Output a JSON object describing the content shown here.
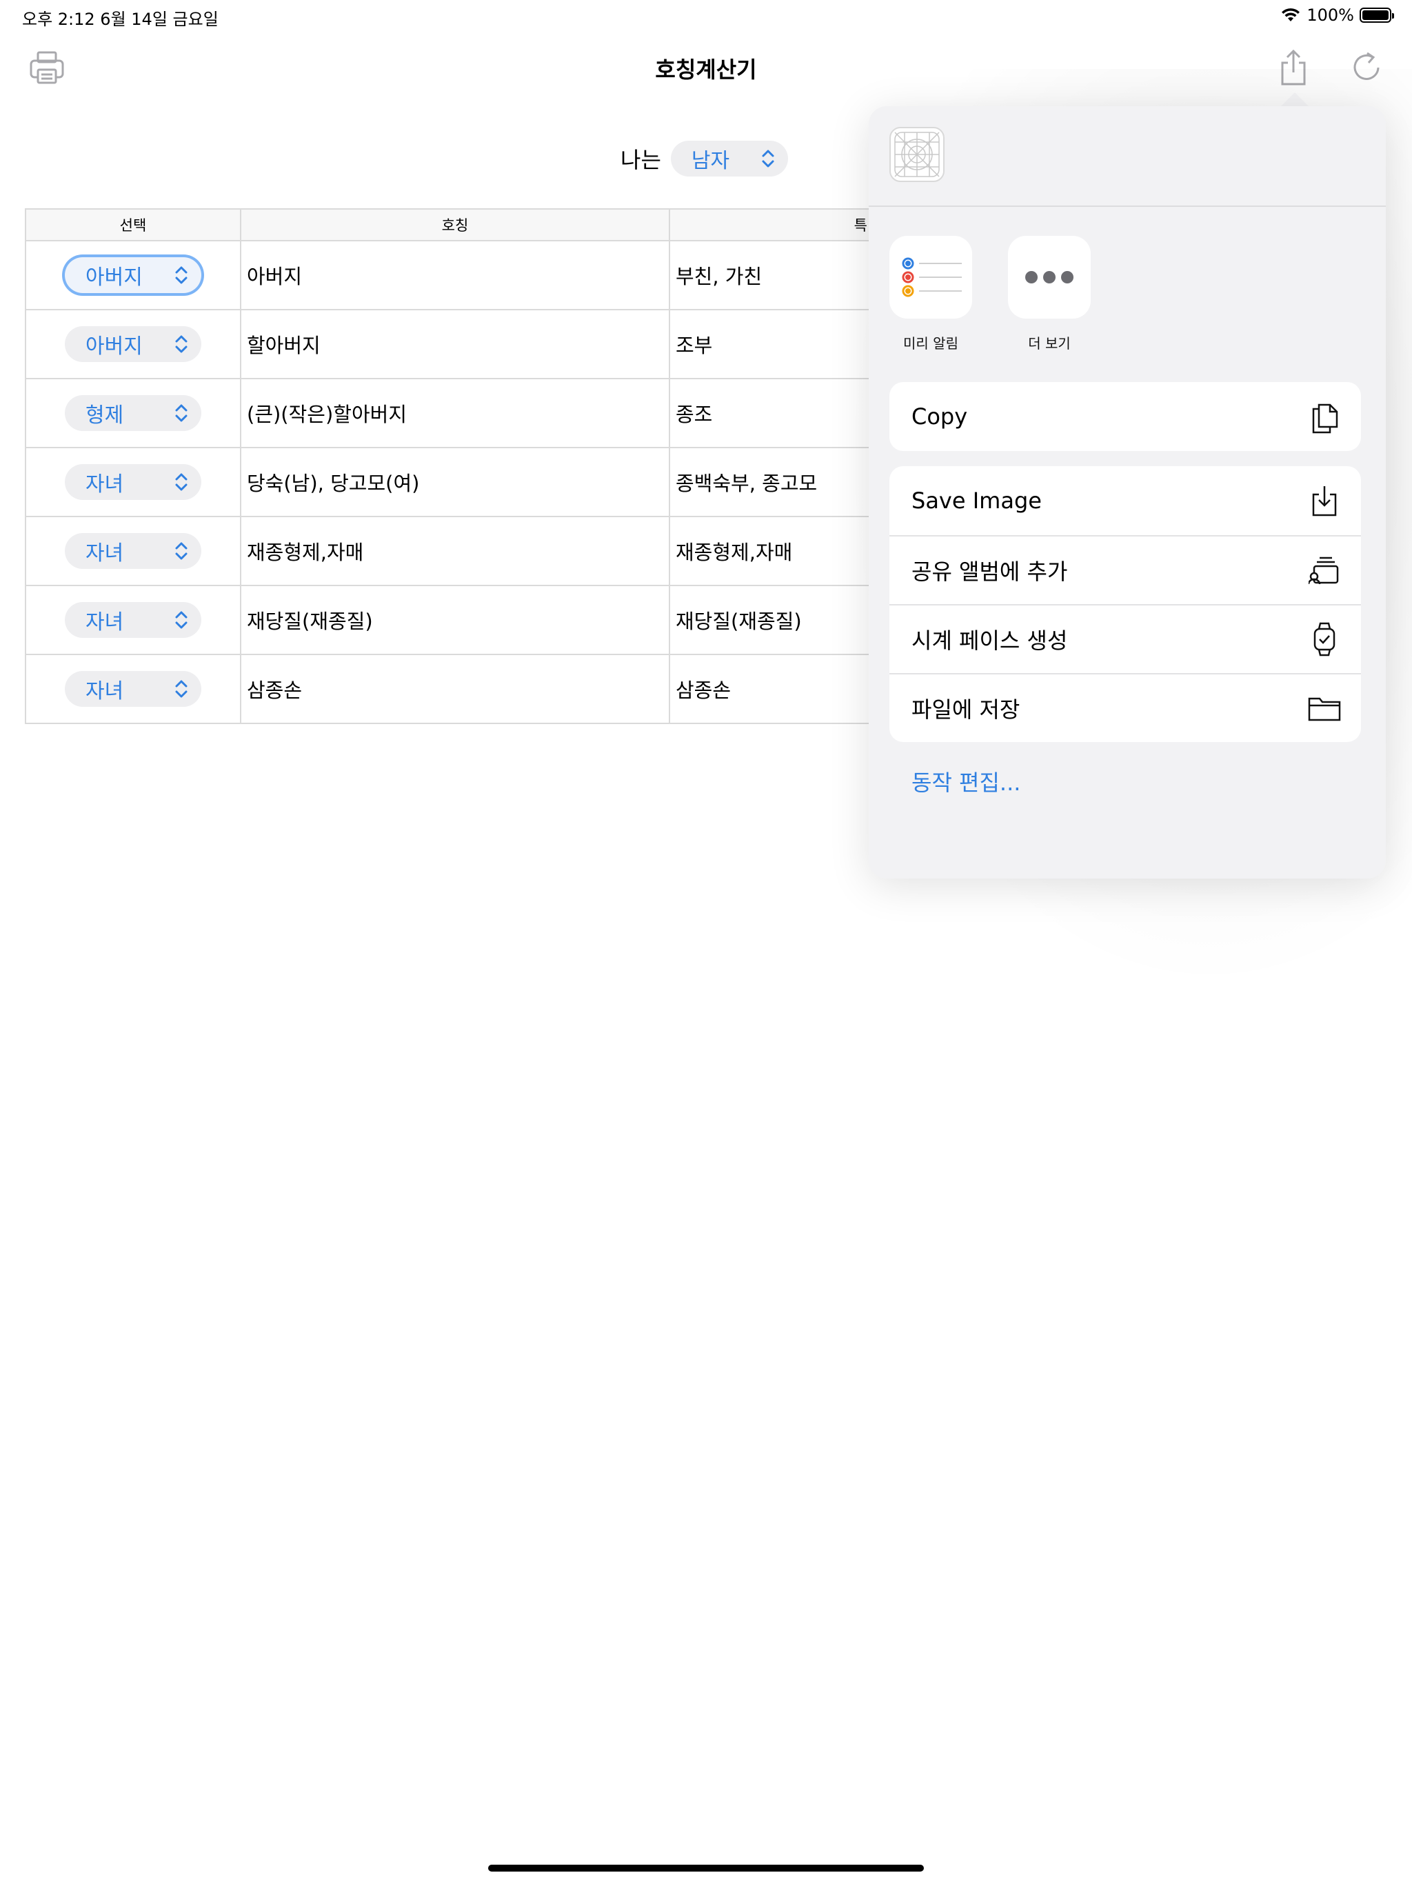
{
  "status_bar": {
    "time": "오후 2:12   6월 14일 금요일",
    "battery": "100%"
  },
  "nav": {
    "title": "호칭계산기"
  },
  "gender": {
    "label": "나는",
    "value": "남자"
  },
  "table": {
    "headers": [
      "선택",
      "호칭",
      "특"
    ],
    "rows": [
      {
        "select": "아버지",
        "title": "아버지",
        "alt": "부친, 가친"
      },
      {
        "select": "아버지",
        "title": "할아버지",
        "alt": "조부"
      },
      {
        "select": "형제",
        "title": "(큰)(작은)할아버지",
        "alt": "종조"
      },
      {
        "select": "자녀",
        "title": "당숙(남), 당고모(여)",
        "alt": "종백숙부, 종고모"
      },
      {
        "select": "자녀",
        "title": "재종형제,자매",
        "alt": "재종형제,자매"
      },
      {
        "select": "자녀",
        "title": "재당질(재종질)",
        "alt": "재당질(재종질)"
      },
      {
        "select": "자녀",
        "title": "삼종손",
        "alt": "삼종손"
      }
    ]
  },
  "share_sheet": {
    "apps": [
      {
        "label": "미리 알림",
        "icon": "reminders-icon"
      },
      {
        "label": "더 보기",
        "icon": "more-icon"
      }
    ],
    "copy_label": "Copy",
    "actions": [
      {
        "label": "Save Image",
        "icon": "save-image-icon"
      },
      {
        "label": "공유 앨범에 추가",
        "icon": "shared-album-icon"
      },
      {
        "label": "시계 페이스 생성",
        "icon": "watch-icon"
      },
      {
        "label": "파일에 저장",
        "icon": "folder-icon"
      }
    ],
    "edit_actions": "동작 편집..."
  },
  "colors": {
    "accent": "#2f7fe0",
    "sheet_bg": "#f2f2f4",
    "stepper_bg": "#eeeef0"
  }
}
